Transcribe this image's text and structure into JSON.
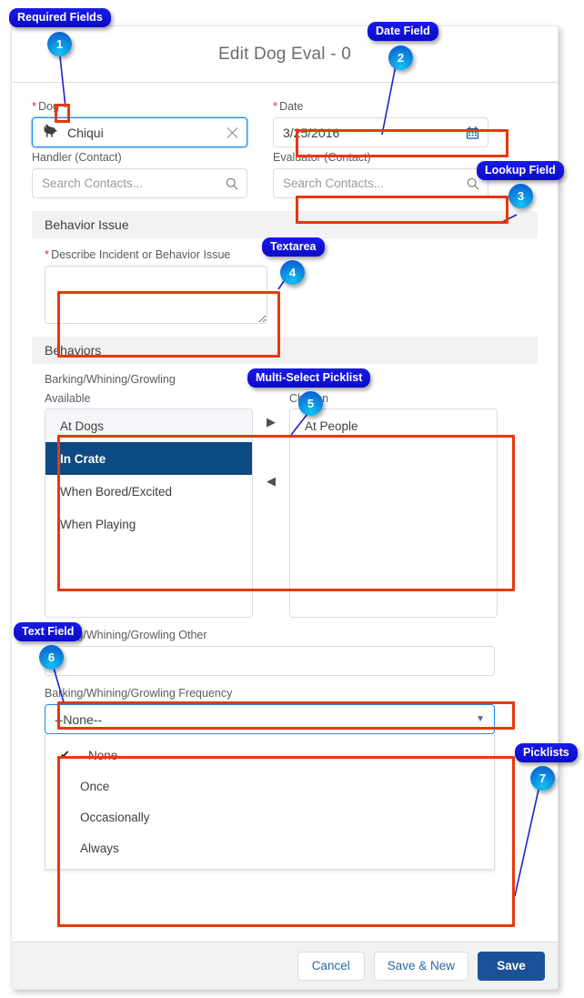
{
  "window": {
    "title": "Edit Dog Eval - 0"
  },
  "colors": {
    "brand_blue": "#1b5297",
    "focus_blue": "#1589ee",
    "annotation_red": "#e8380d",
    "callout_blue": "#1414e0",
    "badge_cyan": "#12c2f5",
    "required_red": "#c23934",
    "selected_navy": "#0d4a84"
  },
  "form": {
    "dog": {
      "label": "Dog",
      "required_marker": "*",
      "value": "Chiqui",
      "clear_icon": "close-x-icon",
      "entity_icon": "dog-icon"
    },
    "date": {
      "label": "Date",
      "required_marker": "*",
      "value": "3/25/2016",
      "icon": "calendar-icon"
    },
    "handler": {
      "label": "Handler (Contact)",
      "placeholder": "Search Contacts...",
      "value": "",
      "icon": "search-icon"
    },
    "evaluator": {
      "label": "Evaluator (Contact)",
      "placeholder": "Search Contacts...",
      "value": "",
      "icon": "search-icon"
    }
  },
  "sections": {
    "behavior_issue": {
      "title": "Behavior Issue",
      "describe": {
        "label": "Describe Incident or Behavior Issue",
        "required_marker": "*",
        "value": "",
        "placeholder": ""
      }
    },
    "behaviors": {
      "title": "Behaviors",
      "multiselect": {
        "label": "Barking/Whining/Growling",
        "available_label": "Available",
        "chosen_label": "Chosen",
        "available": [
          {
            "label": "At Dogs",
            "state": "hover"
          },
          {
            "label": "In Crate",
            "state": "selected"
          },
          {
            "label": "When Bored/Excited",
            "state": "normal"
          },
          {
            "label": "When Playing",
            "state": "normal"
          }
        ],
        "chosen": [
          {
            "label": "At People",
            "state": "normal"
          }
        ],
        "move_right_icon": "triangle-right-icon",
        "move_left_icon": "triangle-left-icon"
      },
      "other_text": {
        "label": "Barking/Whining/Growling Other",
        "value": "",
        "placeholder": ""
      },
      "frequency": {
        "label": "Barking/Whining/Growling Frequency",
        "selected": "--None--",
        "caret_icon": "chevron-down-icon",
        "options": [
          {
            "label": "--None--",
            "checked": true
          },
          {
            "label": "Once",
            "checked": false
          },
          {
            "label": "Occasionally",
            "checked": false
          },
          {
            "label": "Always",
            "checked": false
          }
        ]
      }
    }
  },
  "footer": {
    "cancel": "Cancel",
    "save_and_new": "Save & New",
    "save": "Save"
  },
  "annotations": [
    {
      "n": "1",
      "label": "Required Fields"
    },
    {
      "n": "2",
      "label": "Date Field"
    },
    {
      "n": "3",
      "label": "Lookup Field"
    },
    {
      "n": "4",
      "label": "Textarea"
    },
    {
      "n": "5",
      "label": "Multi-Select Picklist"
    },
    {
      "n": "6",
      "label": "Text Field"
    },
    {
      "n": "7",
      "label": "Picklists"
    }
  ]
}
